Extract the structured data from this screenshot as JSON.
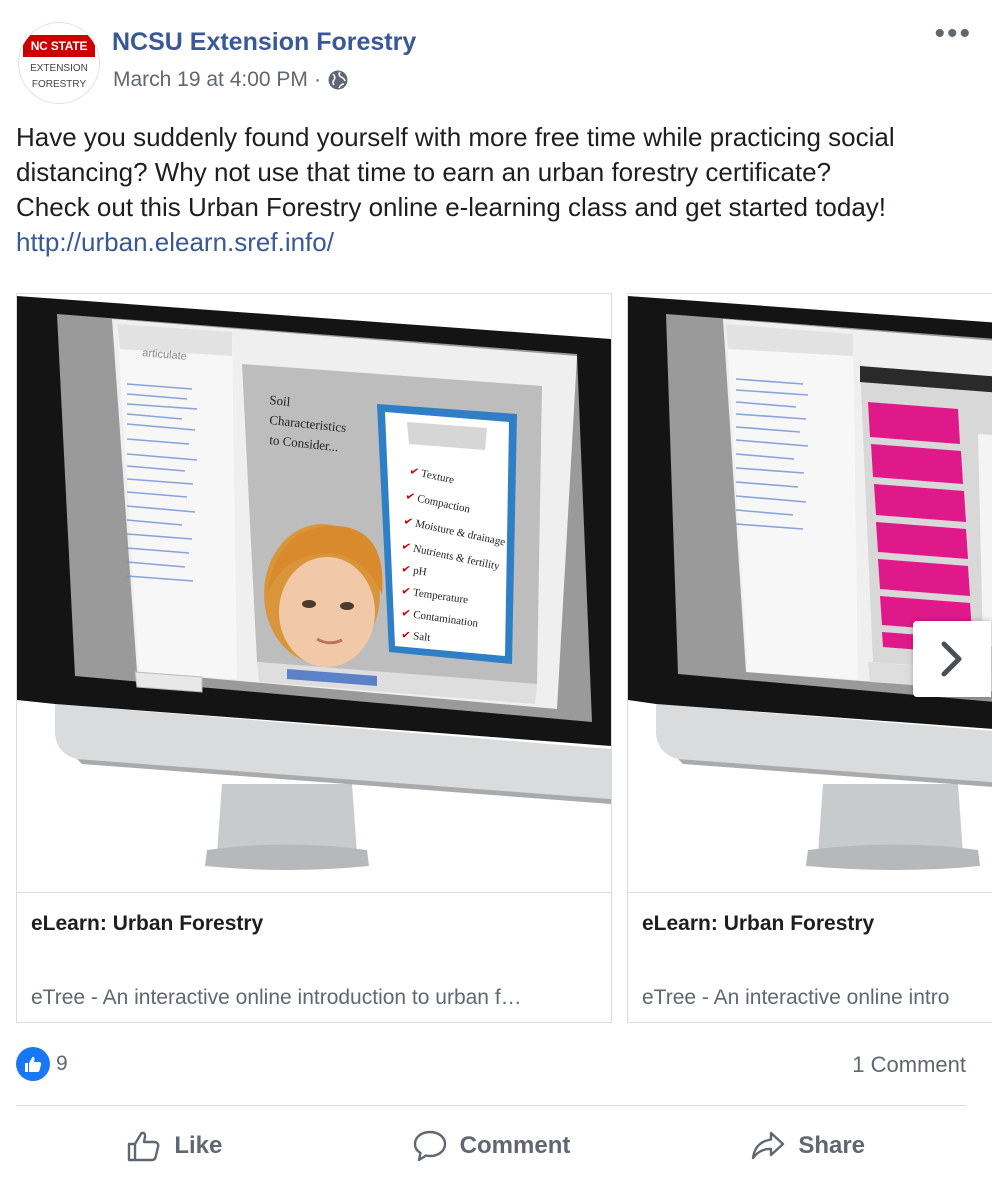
{
  "header": {
    "avatar_logo_top": "NC STATE",
    "avatar_logo_mid": "EXTENSION",
    "avatar_logo_bottom": "FORESTRY",
    "page_name": "NCSU Extension Forestry",
    "timestamp": "March 19 at 4:00 PM",
    "separator": "·",
    "privacy_icon": "globe-icon",
    "more_icon": "•••"
  },
  "post": {
    "text_line1": "Have you suddenly found yourself with more free time while practicing social",
    "text_line2": "distancing? Why not use that time to earn an urban forestry certificate?",
    "text_line3": "Check out this Urban Forestry online e-learning class and get started today!",
    "link": "http://urban.elearn.sref.info/"
  },
  "carousel": {
    "cards": [
      {
        "title": "eLearn: Urban Forestry",
        "description": "eTree - An interactive online introduction to urban f…",
        "screen_heading": "Soil Characteristics to Consider...",
        "screen_brand": "articulate",
        "checklist": [
          "Texture",
          "Compaction",
          "Moisture & drainage",
          "Nutrients & fertility",
          "pH",
          "Temperature",
          "Contamination",
          "Salt"
        ]
      },
      {
        "title": "eLearn: Urban Forestry",
        "description": "eTree - An interactive online intro"
      }
    ],
    "next_icon": "chevron-right-icon"
  },
  "reactions": {
    "like_count": "9",
    "comments": "1 Comment"
  },
  "actions": {
    "like": "Like",
    "comment": "Comment",
    "share": "Share"
  },
  "colors": {
    "link_blue": "#385898",
    "brand_red": "#cc0000",
    "like_blue": "#1877f2",
    "button_pink": "#e0198a"
  }
}
